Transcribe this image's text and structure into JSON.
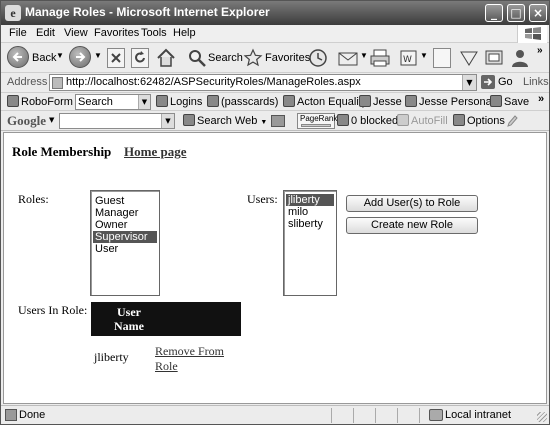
{
  "window": {
    "title": "Manage Roles - Microsoft Internet Explorer",
    "controls": {
      "minimize": "_",
      "maximize": "□",
      "close": "×"
    }
  },
  "menu": [
    "File",
    "Edit",
    "View",
    "Favorites",
    "Tools",
    "Help"
  ],
  "toolbar": {
    "back_label": "Back",
    "search_label": "Search",
    "favorites_label": "Favorites"
  },
  "address": {
    "label": "Address",
    "url": "http://localhost:62482/ASPSecurityRoles/ManageRoles.aspx",
    "go_label": "Go",
    "links_label": "Links"
  },
  "links_bar": {
    "roboform_label": "RoboForm",
    "search_value": "Search",
    "logins_label": "Logins",
    "passcards_label": "(passcards)",
    "acton_label": "Acton Equality",
    "jesse_label": "Jesse",
    "jesse_personal_label": "Jesse Personal",
    "save_label": "Save"
  },
  "google_bar": {
    "logo": "Google",
    "search_web_label": "Search Web",
    "pagerank_label": "PageRank",
    "blocked_label": "0 blocked",
    "autofill_label": "AutoFill",
    "options_label": "Options"
  },
  "page": {
    "heading": "Role Membership",
    "home_link": "Home page",
    "roles_label": "Roles:",
    "users_label": "Users:",
    "roles": [
      {
        "name": "Guest",
        "selected": false
      },
      {
        "name": "Manager",
        "selected": false
      },
      {
        "name": "Owner",
        "selected": false
      },
      {
        "name": "Supervisor",
        "selected": true
      },
      {
        "name": "User",
        "selected": false
      }
    ],
    "users": [
      {
        "name": "jliberty",
        "selected": true
      },
      {
        "name": "milo",
        "selected": false
      },
      {
        "name": "sliberty",
        "selected": false
      }
    ],
    "add_button": "Add User(s) to Role",
    "create_button": "Create new Role",
    "users_in_role_label": "Users In Role:",
    "grid_header": "User Name",
    "grid_rows": [
      {
        "user": "jliberty",
        "action": "Remove From Role"
      }
    ]
  },
  "status": {
    "text": "Done",
    "zone": "Local intranet"
  }
}
